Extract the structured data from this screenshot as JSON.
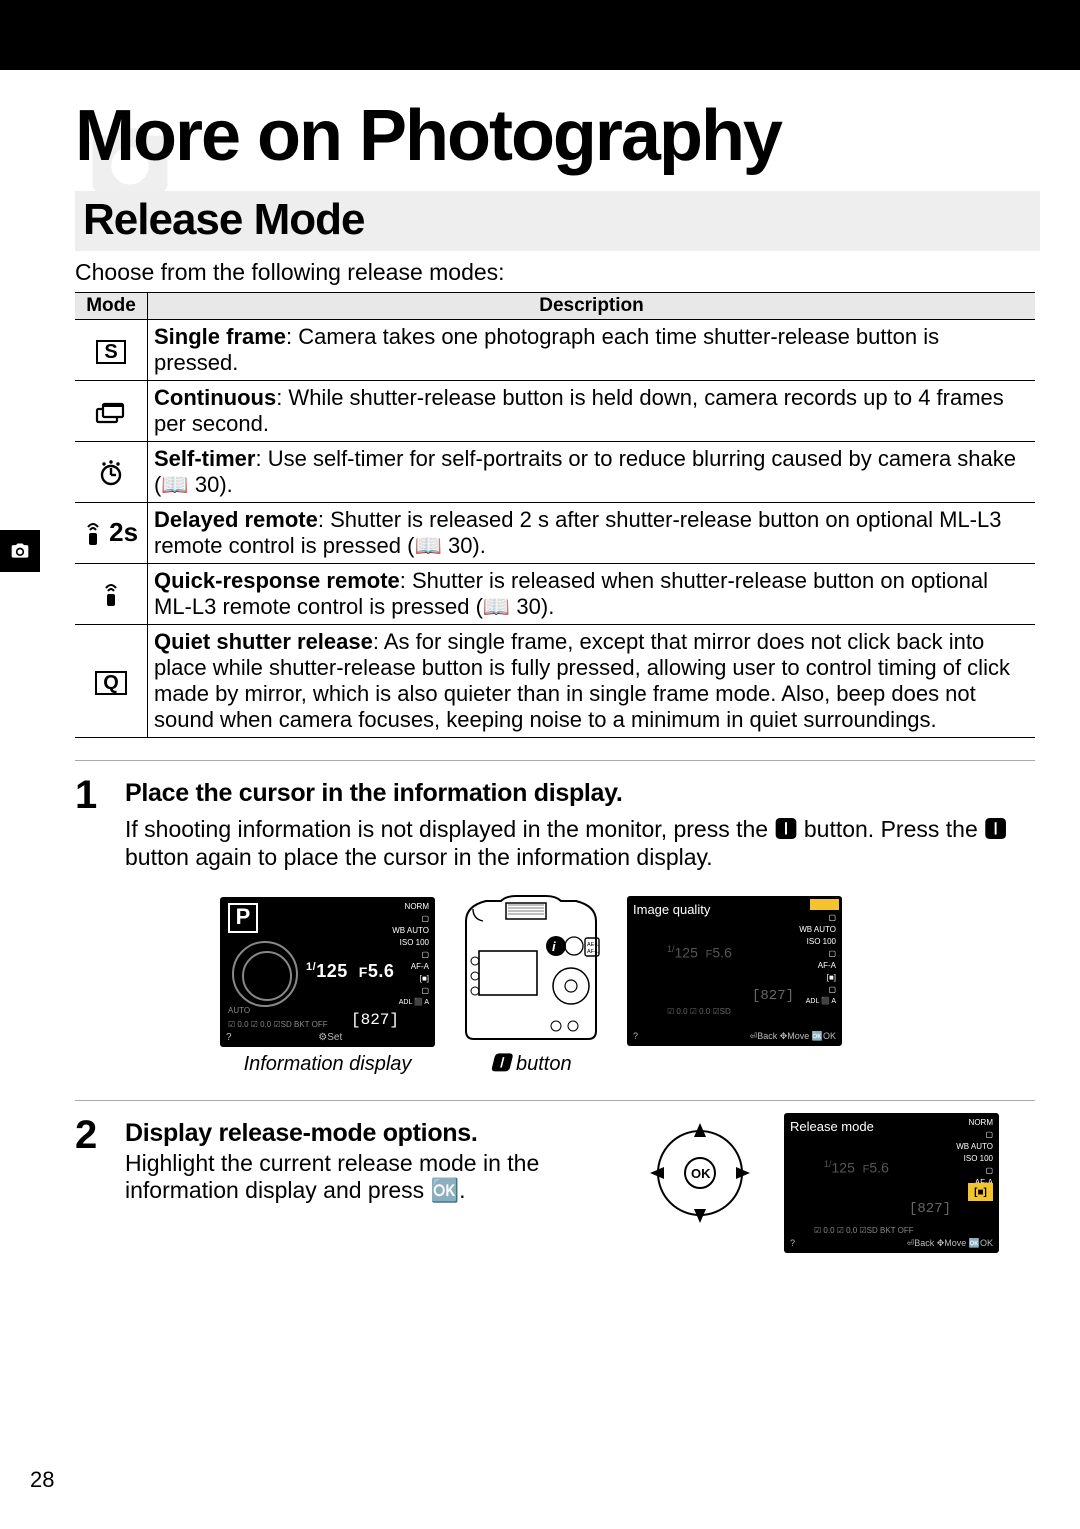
{
  "chapter_title": "More on Photography",
  "section_title": "Release Mode",
  "intro": "Choose from the following release modes:",
  "table": {
    "header_mode": "Mode",
    "header_desc": "Description",
    "rows": [
      {
        "icon": "S",
        "label": "Single frame",
        "text": ": Camera takes one photograph each time shutter-release button is pressed."
      },
      {
        "icon": "continuous",
        "label": "Continuous",
        "text": ": While shutter-release button is held down, camera records up to 4 frames per second."
      },
      {
        "icon": "timer",
        "label": "Self-timer",
        "text": ": Use self-timer for self-portraits or to reduce blurring caused by camera shake (📖 30)."
      },
      {
        "icon": "delayed-remote",
        "label": "Delayed remote",
        "text": ": Shutter is released 2 s after shutter-release button on optional ML-L3 remote control is pressed (📖 30)."
      },
      {
        "icon": "quick-remote",
        "label": "Quick-response remote",
        "text": ": Shutter is released when shutter-release button on optional ML-L3 remote control is pressed (📖 30)."
      },
      {
        "icon": "Q",
        "label": "Quiet shutter release",
        "text": ": As for single frame, except that mirror does not click back into place while shutter-release button is fully pressed, allowing user to control timing of click made by mirror, which is also quieter than in single frame mode. Also, beep does not sound when camera focuses, keeping noise to a minimum in quiet surroundings."
      }
    ]
  },
  "steps": [
    {
      "num": "1",
      "title": "Place the cursor in the information display.",
      "body": "If shooting information is not displayed in the monitor, press the 🅸 button. Press the 🅸 button again to place the cursor in the information display.",
      "figures": [
        {
          "caption": "Information display"
        },
        {
          "caption": "🅸 button"
        }
      ]
    },
    {
      "num": "2",
      "title": "Display release-mode options.",
      "body": "Highlight the current release mode in the information display and press 🆗."
    }
  ],
  "lcd": {
    "mode_letter": "P",
    "shutter_fraction": "1/125",
    "aperture": "F5.6",
    "count": "[827]",
    "right_labels": [
      "NORM",
      "▢",
      "WB AUTO",
      "ISO 100",
      "▢",
      "AF-A",
      "[■]",
      "▢",
      "ADL ⬛ A"
    ],
    "footer_left": "⚙Set",
    "panel1_bottom": "☑ 0.0 ☑ 0.0 ☑SD BKT OFF",
    "highlight_cell": "[■]"
  },
  "lcd_menu1": {
    "title": "Image quality",
    "footer": "⏎Back  ✥Move  🆗OK"
  },
  "lcd_menu2": {
    "title": "Release mode",
    "footer": "⏎Back  ✥Move  🆗OK"
  },
  "page_number": "28"
}
